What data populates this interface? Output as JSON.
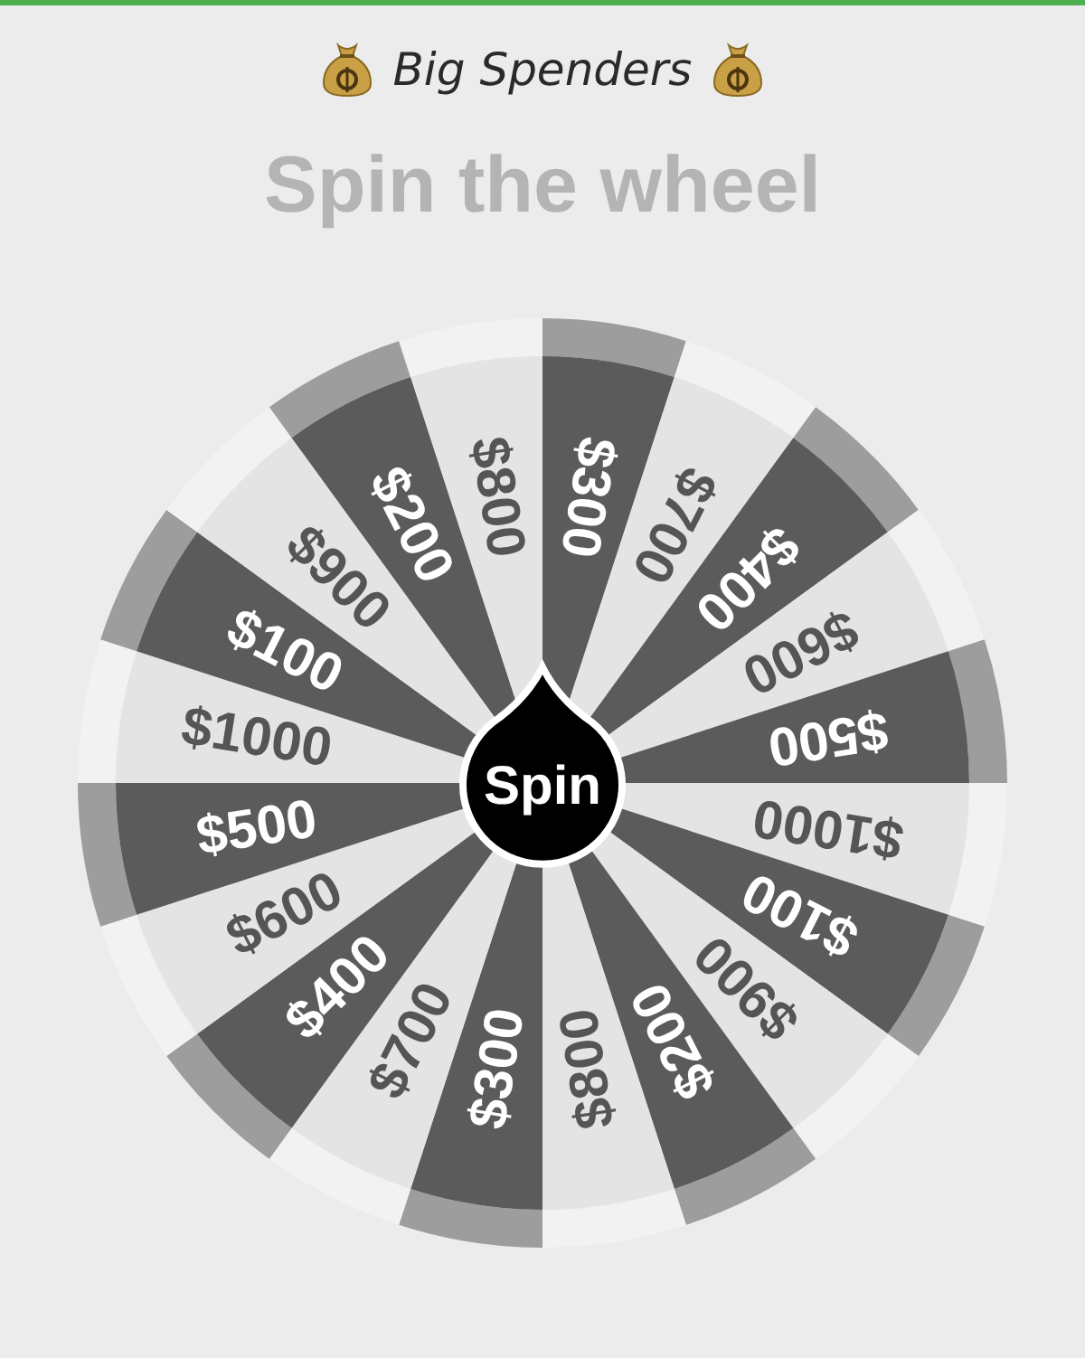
{
  "header": {
    "title": "Big Spenders"
  },
  "heading": "Spin the wheel",
  "wheel": {
    "button": "Spin",
    "segments": [
      {
        "label": "$300",
        "color": "#5b5b5b"
      },
      {
        "label": "$700",
        "color": "#e4e4e4"
      },
      {
        "label": "$400",
        "color": "#5b5b5b"
      },
      {
        "label": "$600",
        "color": "#e4e4e4"
      },
      {
        "label": "$500",
        "color": "#5b5b5b"
      },
      {
        "label": "$1000",
        "color": "#e4e4e4"
      },
      {
        "label": "$100",
        "color": "#5b5b5b"
      },
      {
        "label": "$900",
        "color": "#e4e4e4"
      },
      {
        "label": "$200",
        "color": "#5b5b5b"
      },
      {
        "label": "$800",
        "color": "#e4e4e4"
      },
      {
        "label": "$300",
        "color": "#5b5b5b"
      },
      {
        "label": "$700",
        "color": "#e4e4e4"
      },
      {
        "label": "$400",
        "color": "#5b5b5b"
      },
      {
        "label": "$600",
        "color": "#e4e4e4"
      },
      {
        "label": "$500",
        "color": "#5b5b5b"
      },
      {
        "label": "$1000",
        "color": "#e4e4e4"
      },
      {
        "label": "$100",
        "color": "#5b5b5b"
      },
      {
        "label": "$900",
        "color": "#e4e4e4"
      },
      {
        "label": "$200",
        "color": "#5b5b5b"
      },
      {
        "label": "$800",
        "color": "#e4e4e4"
      }
    ]
  }
}
